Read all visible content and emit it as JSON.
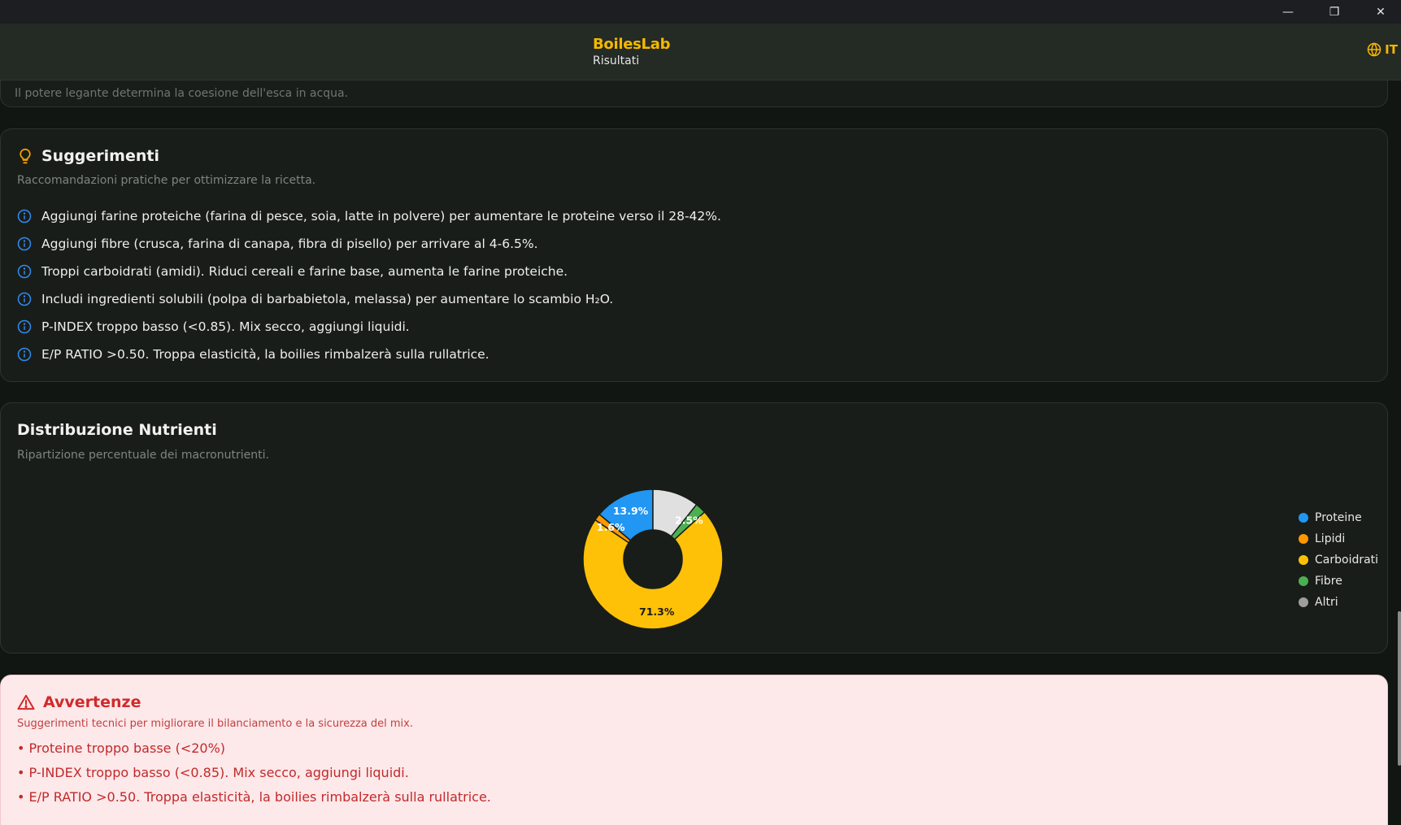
{
  "window": {
    "minimize_glyph": "—",
    "maximize_glyph": "❐",
    "close_glyph": "✕"
  },
  "header": {
    "app_title": "BoilesLab",
    "subtitle": "Risultati",
    "language": "IT"
  },
  "previous_card": {
    "text": "Il potere legante determina la coesione dell'esca in acqua."
  },
  "suggestions": {
    "title": "Suggerimenti",
    "description": "Raccomandazioni pratiche per ottimizzare la ricetta.",
    "items": [
      "Aggiungi farine proteiche (farina di pesce, soia, latte in polvere) per aumentare le proteine verso il 28-42%.",
      "Aggiungi fibre (crusca, farina di canapa, fibra di pisello) per arrivare al 4-6.5%.",
      "Troppi carboidrati (amidi). Riduci cereali e farine base, aumenta le farine proteiche.",
      "Includi ingredienti solubili (polpa di barbabietola, melassa) per aumentare lo scambio H₂O.",
      "P-INDEX troppo basso (<0.85). Mix secco, aggiungi liquidi.",
      "E/P RATIO >0.50. Troppa elasticità, la boilies rimbalzerà sulla rullatrice."
    ]
  },
  "distribution": {
    "title": "Distribuzione Nutrienti",
    "description": "Ripartizione percentuale dei macronutrienti."
  },
  "chart_data": {
    "type": "pie",
    "variant": "donut",
    "categories": [
      "Proteine",
      "Lipidi",
      "Carboidrati",
      "Fibre",
      "Altri"
    ],
    "values": [
      13.9,
      1.6,
      71.3,
      2.5,
      10.7
    ],
    "data_labels": [
      "13.9%",
      "1.6%",
      "71.3%",
      "2.5%",
      ""
    ],
    "colors": [
      "#2196f3",
      "#ff9800",
      "#ffc107",
      "#4caf50",
      "#e0e0e0"
    ],
    "legend_colors": [
      "#2196f3",
      "#ff9800",
      "#ffc107",
      "#4caf50",
      "#9e9e9e"
    ],
    "legend": "right",
    "start_angle_deg": 90
  },
  "warnings": {
    "title": "Avvertenze",
    "description": "Suggerimenti tecnici per migliorare il bilanciamento e la sicurezza del mix.",
    "items": [
      "• Proteine troppo basse (<20%)",
      "• P-INDEX troppo basso (<0.85). Mix secco, aggiungi liquidi.",
      "• E/P RATIO >0.50. Troppa elasticità, la boilies rimbalzerà sulla rullatrice."
    ]
  }
}
